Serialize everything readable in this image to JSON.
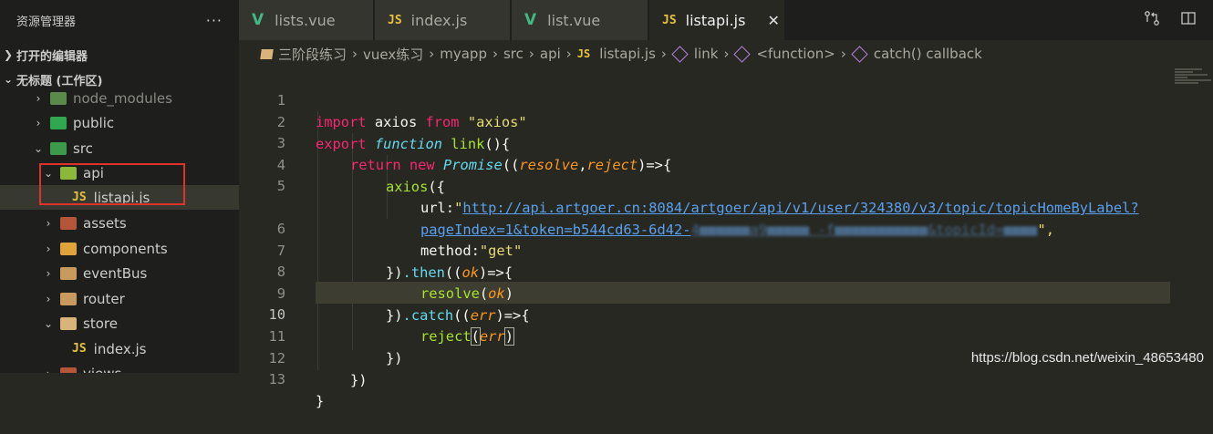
{
  "sidebar": {
    "title": "资源管理器",
    "more": "···",
    "sections": {
      "open_editors": "打开的编辑器",
      "workspace": "无标题 (工作区)"
    },
    "tree": [
      {
        "label": "node_modules",
        "icon": "node-folder-icon"
      },
      {
        "label": "public",
        "icon": "public-folder-icon"
      },
      {
        "label": "src",
        "icon": "src-folder-icon"
      },
      {
        "label": "api",
        "icon": "api-folder-icon"
      },
      {
        "label": "listapi.js",
        "icon": "js-file-icon",
        "badge": "JS"
      },
      {
        "label": "assets",
        "icon": "assets-folder-icon"
      },
      {
        "label": "components",
        "icon": "components-folder-icon"
      },
      {
        "label": "eventBus",
        "icon": "folder-icon"
      },
      {
        "label": "router",
        "icon": "folder-icon"
      },
      {
        "label": "store",
        "icon": "folder-open-icon"
      },
      {
        "label": "index.js",
        "icon": "js-file-icon",
        "badge": "JS"
      },
      {
        "label": "views",
        "icon": "views-folder-icon"
      }
    ]
  },
  "tabs": [
    {
      "label": "lists.vue",
      "icon": "vue-icon",
      "glyph": "V"
    },
    {
      "label": "index.js",
      "icon": "js-icon",
      "glyph": "JS"
    },
    {
      "label": "list.vue",
      "icon": "vue-icon",
      "glyph": "V"
    },
    {
      "label": "listapi.js",
      "icon": "js-icon",
      "glyph": "JS",
      "active": true,
      "close": "✕"
    }
  ],
  "breadcrumb": {
    "items": [
      "三阶段练习",
      "vuex练习",
      "myapp",
      "src",
      "api",
      "listapi.js",
      "link",
      "<function>",
      "catch() callback"
    ],
    "js_badge": "JS",
    "separator": "›"
  },
  "editor": {
    "line_numbers": [
      "1",
      "2",
      "3",
      "4",
      "5",
      "",
      "6",
      "7",
      "8",
      "9",
      "10",
      "11",
      "12",
      "13"
    ],
    "code": {
      "l1": {
        "import": "import",
        "name": " axios ",
        "from": "from",
        "str": " \"axios\""
      },
      "l2": {
        "export": "export",
        "function": " function",
        "name": " link",
        "rest": "(){"
      },
      "l3": {
        "return": "return",
        "new": " new",
        "promise": " Promise",
        "p1": "((",
        "resolve": "resolve",
        "comma": ",",
        "reject": "reject",
        "arrow": ")=>{"
      },
      "l4": {
        "call": "axios",
        "rest": "({"
      },
      "l5": {
        "key": "url:",
        "quote": "\"",
        "url": "http://api.artgoer.cn:8084/artgoer/api/v1/user/324380/v3/topic/topicHomeByLabel?"
      },
      "l5b": {
        "url": "pageIndex=1&token=b544cd63-6d42-",
        "blur": "4■■■■■■a9■■■■■ -f■■■■■■■■■■■&topicId=■■■■",
        "tail": "\","
      },
      "l6": {
        "key": "method:",
        "str": "\"get\""
      },
      "l7": {
        "close": "})",
        "then": ".then",
        "p1": "((",
        "ok": "ok",
        "arrow": ")=>{"
      },
      "l8": {
        "call": "resolve",
        "p1": "(",
        "ok": "ok",
        "p2": ")"
      },
      "l9": {
        "close": "})",
        "catch": ".catch",
        "p1": "((",
        "err": "err",
        "arrow": ")=>{"
      },
      "l10": {
        "call": "reject",
        "p1": "(",
        "err": "err",
        "p2": ")"
      },
      "l11": {
        "close": "})"
      },
      "l12": {
        "close": "})"
      },
      "l13": {
        "close": "}"
      }
    }
  },
  "watermark": "https://blog.csdn.net/weixin_48653480",
  "colors": {
    "background": "#272822",
    "sidebar": "#1e1f1c",
    "annotation_box": "#e0312a",
    "keyword": "#f92672",
    "string": "#e6db74",
    "function": "#a6e22e"
  }
}
